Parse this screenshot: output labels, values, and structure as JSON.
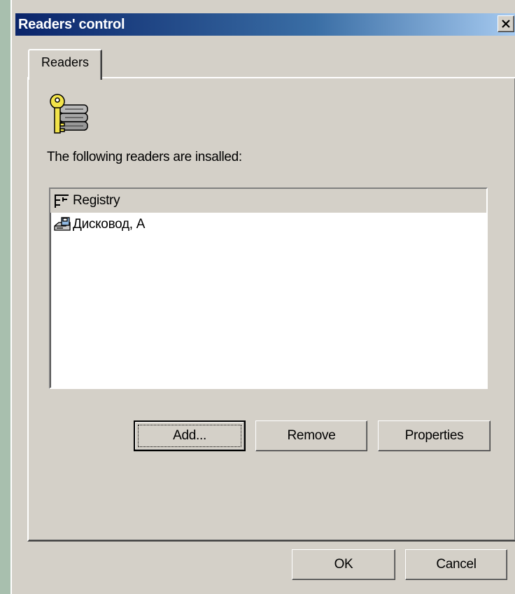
{
  "window": {
    "title": "Readers' control"
  },
  "tabs": [
    {
      "label": "Readers"
    }
  ],
  "panel": {
    "description": "The following readers are insalled:",
    "readers": [
      {
        "name": "Registry",
        "icon": "registry-icon",
        "selected": true
      },
      {
        "name": "Дисковод, A",
        "icon": "floppy-drive-icon",
        "selected": false
      }
    ]
  },
  "buttons": {
    "add": "Add...",
    "remove": "Remove",
    "properties": "Properties",
    "ok": "OK",
    "cancel": "Cancel"
  },
  "colors": {
    "title_start": "#0a246a",
    "title_end": "#a6caf0",
    "face": "#d4d0c8",
    "desktop": "#a8bfae"
  }
}
